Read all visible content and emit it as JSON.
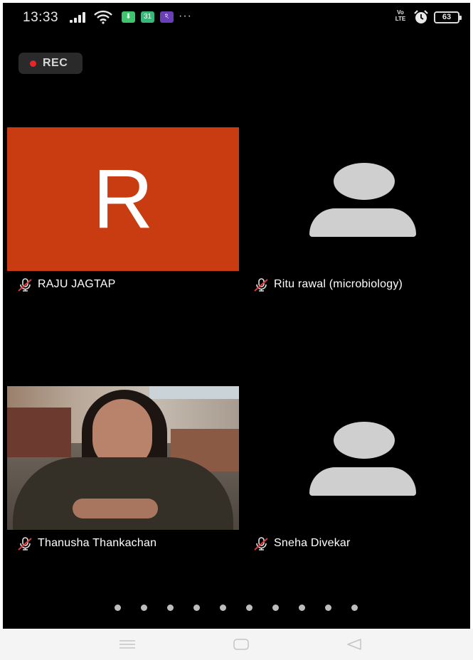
{
  "status_bar": {
    "time": "13:33",
    "notification_badges": [
      {
        "name": "download-badge",
        "color": "#3ec46d",
        "glyph": "⬇"
      },
      {
        "name": "calendar-badge",
        "color": "#38b77a",
        "glyph": "31"
      },
      {
        "name": "app-badge",
        "color": "#6b3fb8",
        "glyph": "ঽ"
      }
    ],
    "more_indicator": "···",
    "volte_label_top": "Vo",
    "volte_label_bottom": "LTE",
    "battery_level": "63"
  },
  "recording": {
    "label": "REC",
    "dot_color": "#e8262a"
  },
  "participants": [
    {
      "name": "RAJU JAGTAP",
      "avatar_type": "letter",
      "avatar_letter": "R",
      "avatar_color": "#c93b10",
      "muted": true
    },
    {
      "name": "Ritu rawal (microbiology)",
      "avatar_type": "placeholder",
      "muted": true
    },
    {
      "name": "Thanusha Thankachan",
      "avatar_type": "video",
      "muted": true
    },
    {
      "name": "Sneha Divekar",
      "avatar_type": "placeholder",
      "muted": true
    }
  ],
  "pagination": {
    "page_count": 10,
    "current_page": 1
  },
  "navigation_bar": {
    "buttons": [
      "menu-icon",
      "home-icon",
      "back-icon"
    ]
  }
}
